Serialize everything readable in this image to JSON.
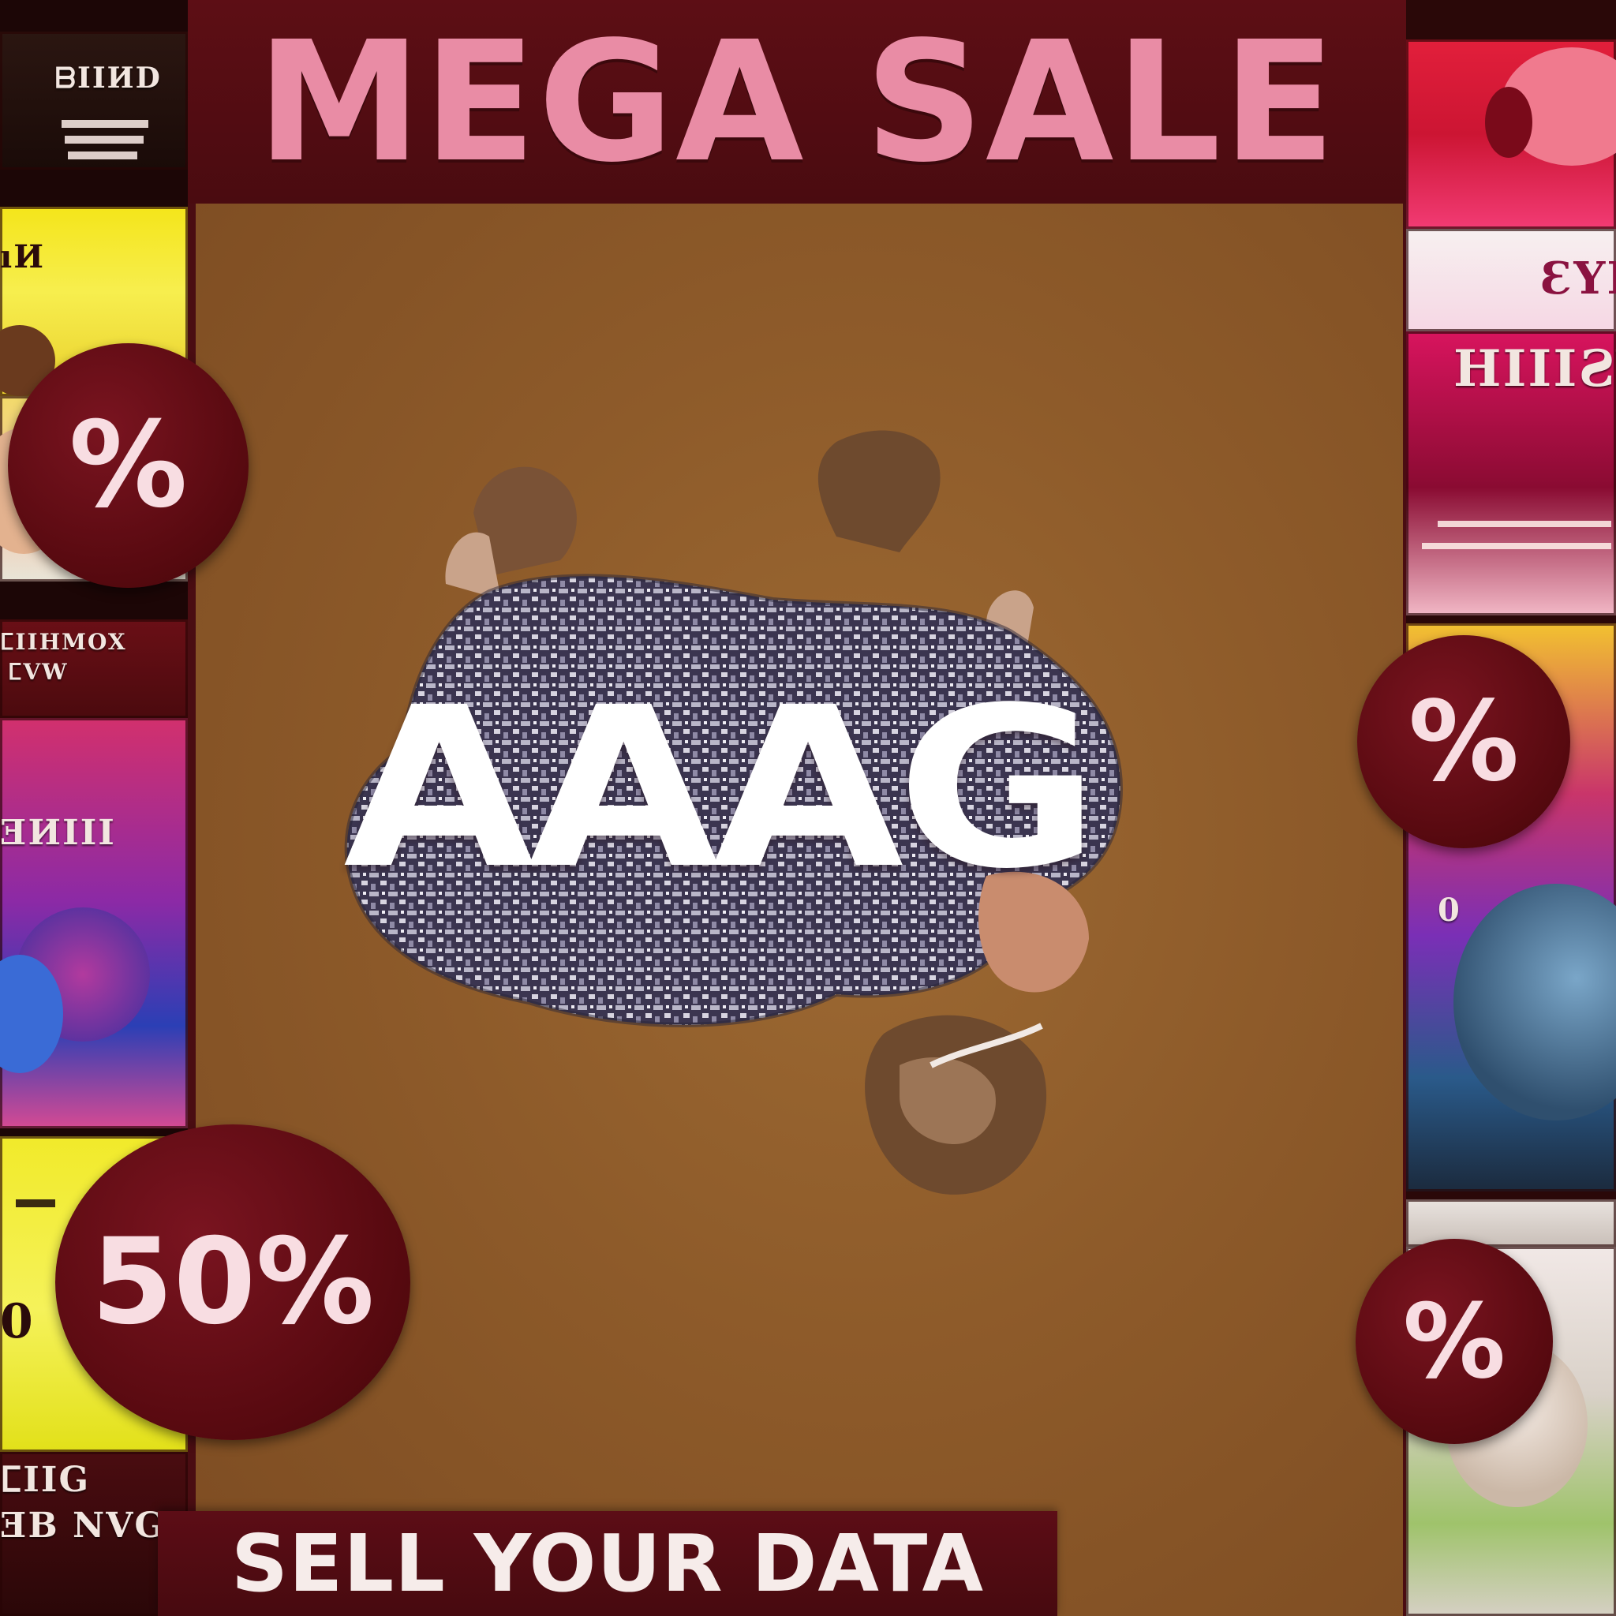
{
  "poster": {
    "headline": "MEGA SALE",
    "center_word": "AAAG",
    "banner": "SELL YOUR DATA"
  },
  "badges": {
    "left_top": "%",
    "left_bottom": "50%",
    "right_top": "%",
    "right_bottom": "%"
  },
  "left_strip": {
    "panel1_text": "ᗷIIИD",
    "panel2_text": "ıИ",
    "panel4_text": "ⵎIIHMOX",
    "panel4_sub": "ⵎVW",
    "panel5_text": "ƎИIII",
    "panel6_text": "0",
    "panel7_text": "ⵎIIG",
    "panel7_sub": "ƎB NVG"
  },
  "right_strip": {
    "panel2_text": "ƐYI",
    "panel3_text": "HIIIƧY",
    "panel4_text": "0"
  },
  "colors": {
    "maroon": "#4a0d12",
    "board_brown": "#8e5b2a",
    "headline_pink": "#e98ca5",
    "banner_text": "#f6ecea",
    "badge_text": "#f8dde2"
  }
}
